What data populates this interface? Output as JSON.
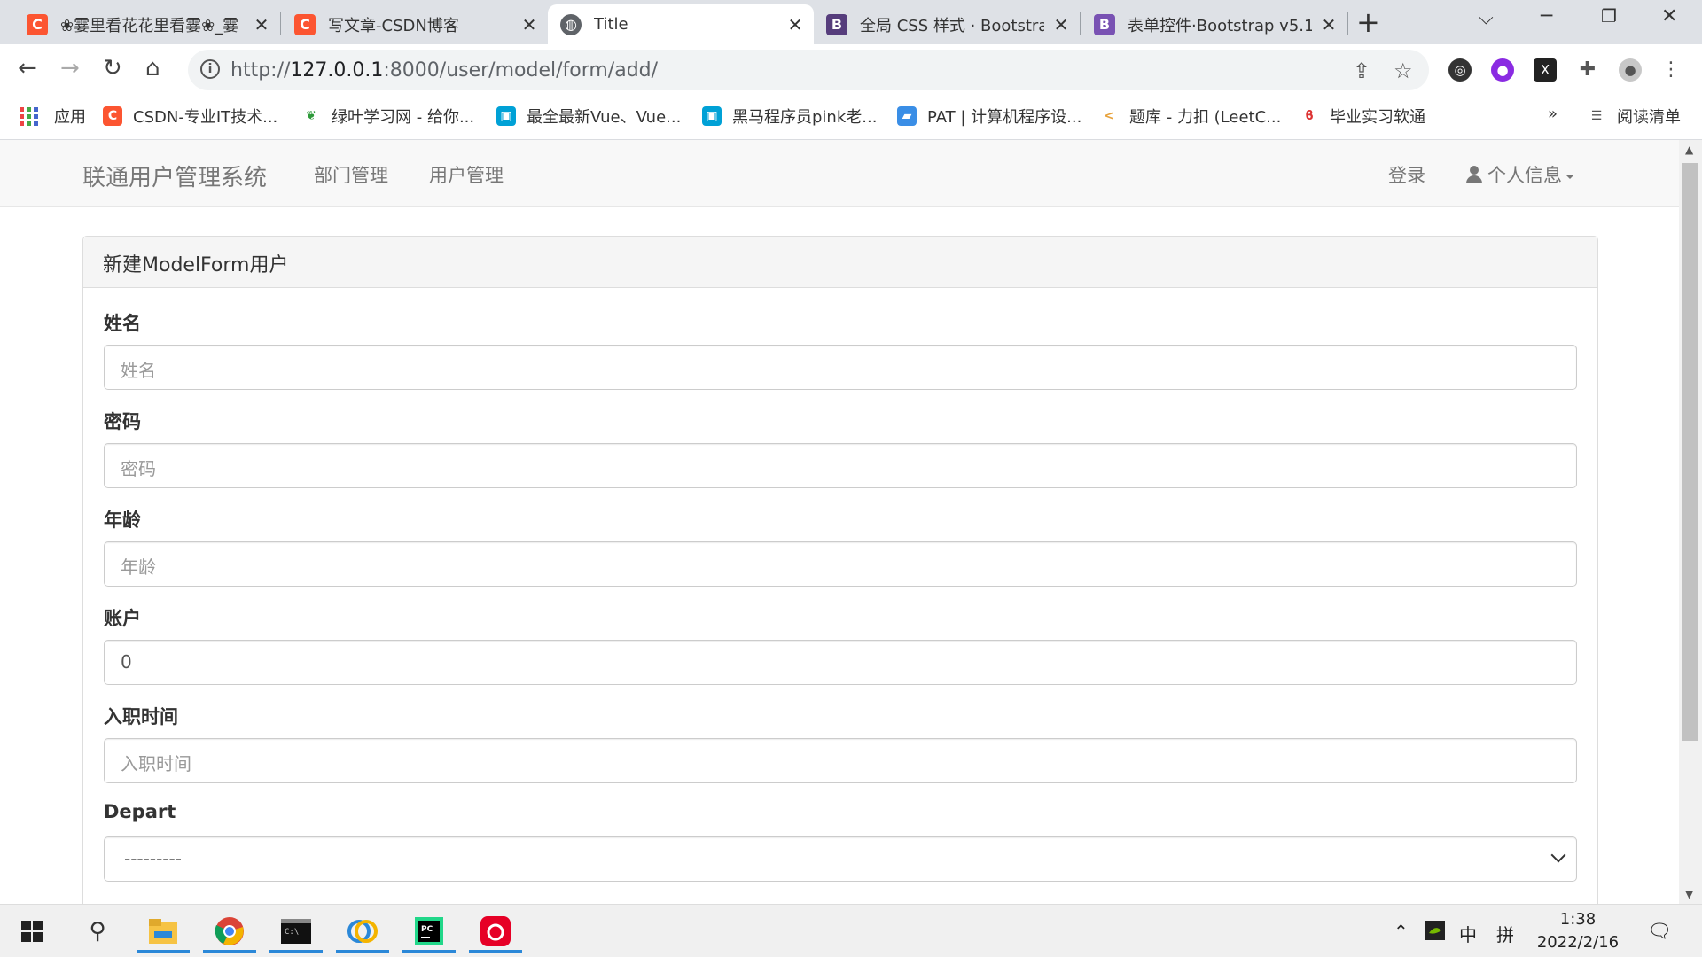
{
  "browser": {
    "tabs": [
      {
        "title": "❀霎里看花花里看霎❀_霎",
        "icon": "C",
        "icon_color": "#fc5531"
      },
      {
        "title": "写文章-CSDN博客",
        "icon": "C",
        "icon_color": "#fc5531"
      },
      {
        "title": "Title",
        "icon": "globe",
        "icon_color": "#5f6368"
      },
      {
        "title": "全局 CSS 样式 · Bootstrap",
        "icon": "B",
        "icon_color": "#563d7c"
      },
      {
        "title": "表单控件·Bootstrap v5.1",
        "icon": "B",
        "icon_color": "#7952b3"
      }
    ],
    "new_tab": "+",
    "address": {
      "protocol": "http://",
      "host": "127.0.0.1",
      "path": ":8000/user/model/form/add/"
    },
    "bookmarks": [
      {
        "label": "应用"
      },
      {
        "label": "CSDN-专业IT技术..."
      },
      {
        "label": "绿叶学习网 - 给你..."
      },
      {
        "label": "最全最新Vue、Vue..."
      },
      {
        "label": "黑马程序员pink老..."
      },
      {
        "label": "PAT | 计算机程序设..."
      },
      {
        "label": "题库 - 力扣 (LeetC..."
      },
      {
        "label": "毕业实习软通"
      }
    ],
    "more": "»",
    "reading_list": "阅读清单"
  },
  "app": {
    "brand": "联通用户管理系统",
    "nav": [
      "部门管理",
      "用户管理"
    ],
    "login": "登录",
    "profile": "个人信息"
  },
  "panel": {
    "title": "新建ModelForm用户",
    "fields": [
      {
        "label": "姓名",
        "placeholder": "姓名",
        "value": ""
      },
      {
        "label": "密码",
        "placeholder": "密码",
        "value": ""
      },
      {
        "label": "年龄",
        "placeholder": "年龄",
        "value": ""
      },
      {
        "label": "账户",
        "placeholder": "",
        "value": "0"
      },
      {
        "label": "入职时间",
        "placeholder": "入职时间",
        "value": ""
      },
      {
        "label": "Depart",
        "placeholder": "",
        "value": "---------"
      }
    ]
  },
  "taskbar": {
    "ime_lang": "中",
    "ime_mode": "拼",
    "time": "1:38",
    "date": "2022/2/16"
  }
}
